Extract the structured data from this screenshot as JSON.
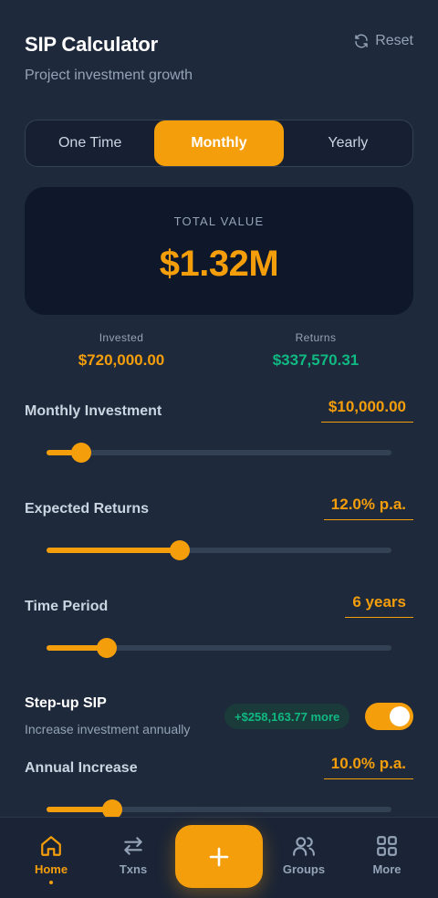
{
  "header": {
    "title": "SIP Calculator",
    "subtitle": "Project investment growth",
    "reset_label": "Reset"
  },
  "segments": {
    "items": [
      "One Time",
      "Monthly",
      "Yearly"
    ],
    "selected": "Monthly"
  },
  "summary": {
    "total_label": "TOTAL VALUE",
    "total_value": "$1.32M",
    "invested_label": "Invested",
    "invested_value": "$720,000.00",
    "returns_label": "Returns",
    "returns_value": "$337,570.31"
  },
  "inputs": {
    "monthly": {
      "label": "Monthly Investment",
      "value": "$10,000.00",
      "fraction": 0.1
    },
    "returns": {
      "label": "Expected Returns",
      "value": "12.0% p.a.",
      "fraction": 0.385
    },
    "period": {
      "label": "Time Period",
      "value": "6 years",
      "fraction": 0.175
    },
    "annual": {
      "label": "Annual Increase",
      "value": "10.0% p.a.",
      "fraction": 0.19
    }
  },
  "stepup": {
    "title": "Step-up SIP",
    "subtitle": "Increase investment annually",
    "badge": "+$258,163.77 more",
    "enabled": true
  },
  "nav": {
    "items": [
      "Home",
      "Txns",
      "Groups",
      "More"
    ],
    "active": "Home"
  },
  "colors": {
    "accent": "#f59e0b",
    "positive": "#10b981",
    "background": "#1e293b",
    "card": "#0f172a"
  },
  "icons": {
    "reset": "refresh-icon",
    "home": "home-icon",
    "txns": "swap-arrows-icon",
    "add": "plus-icon",
    "groups": "users-icon",
    "more": "grid-icon"
  }
}
